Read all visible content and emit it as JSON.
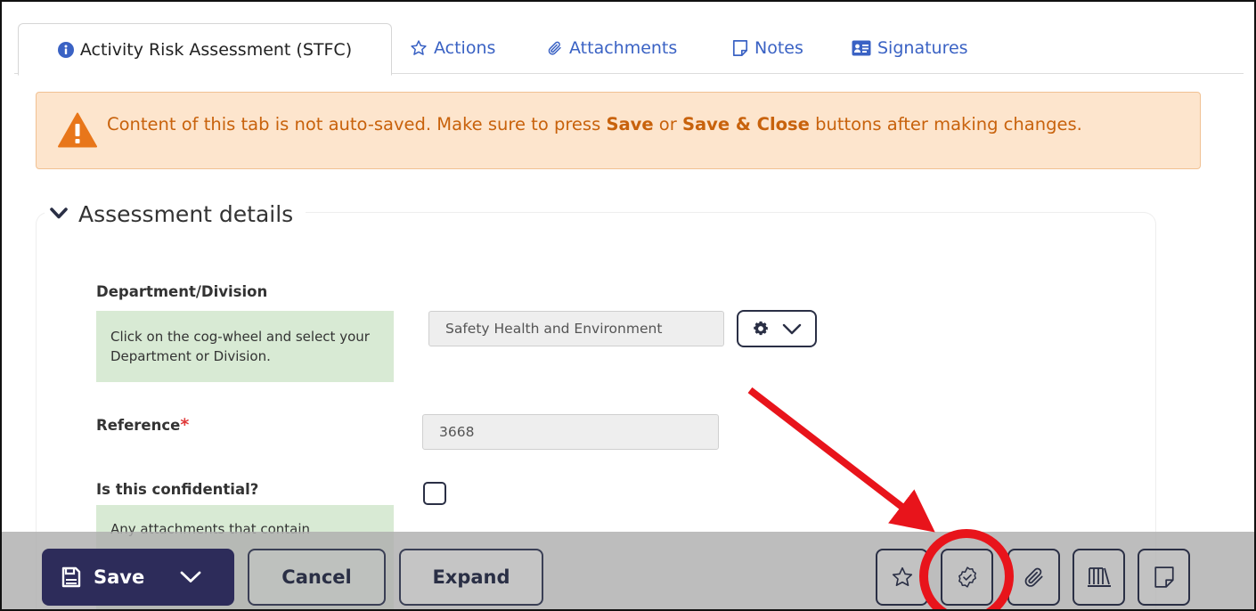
{
  "tabs": [
    {
      "label": "Activity Risk Assessment (STFC)",
      "icon": "info-circle-icon",
      "active": true
    },
    {
      "label": "Actions",
      "icon": "star-icon"
    },
    {
      "label": "Attachments",
      "icon": "paperclip-icon"
    },
    {
      "label": "Notes",
      "icon": "note-icon"
    },
    {
      "label": "Signatures",
      "icon": "id-card-icon"
    }
  ],
  "alert": {
    "text_1": "Content of this tab is not auto-saved. Make sure to press ",
    "save": "Save",
    "text_2": " or ",
    "save_close": "Save & Close",
    "text_3": " buttons after making changes."
  },
  "section": {
    "title": "Assessment details"
  },
  "form": {
    "department": {
      "label": "Department/Division",
      "help": "Click on the cog-wheel and select your Department or Division.",
      "value": "Safety Health and Environment"
    },
    "reference": {
      "label": "Reference",
      "required_mark": "*",
      "value": "3668"
    },
    "confidential": {
      "label": "Is this confidential?",
      "help_visible": "Any attachments that contain",
      "checked": false
    }
  },
  "toolbar": {
    "save_label": "Save",
    "cancel_label": "Cancel",
    "expand_label": "Expand",
    "icon_buttons": [
      "star-icon",
      "badge-check-icon",
      "paperclip-icon",
      "library-books-icon",
      "sticky-note-icon"
    ]
  },
  "annotation": {
    "color": "#e8141b",
    "target": "badge-check-icon"
  },
  "colors": {
    "accent_blue": "#3a62c4",
    "alert_bg": "#fde5cd",
    "alert_text": "#c8620c",
    "warning_icon": "#e8761a",
    "help_bg": "#d8ead4",
    "save_button_bg": "#2d2c5a",
    "required": "#e03a3a"
  }
}
